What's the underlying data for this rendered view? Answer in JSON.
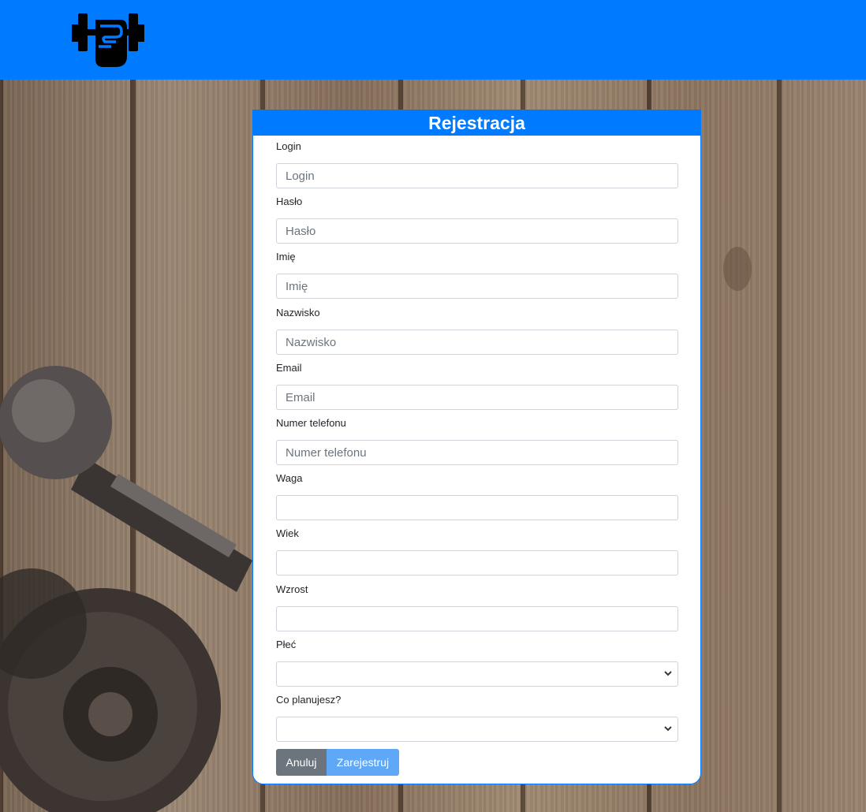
{
  "header": {
    "logo_icon": "dumbbell-fist-icon",
    "color": "#007bff"
  },
  "form": {
    "title": "Rejestracja",
    "fields": [
      {
        "label": "Login",
        "placeholder": "Login",
        "value": ""
      },
      {
        "label": "Hasło",
        "placeholder": "Hasło",
        "value": ""
      },
      {
        "label": "Imię",
        "placeholder": "Imię",
        "value": ""
      },
      {
        "label": "Nazwisko",
        "placeholder": "Nazwisko",
        "value": ""
      },
      {
        "label": "Email",
        "placeholder": "Email",
        "value": ""
      },
      {
        "label": "Numer telefonu",
        "placeholder": "Numer telefonu",
        "value": ""
      },
      {
        "label": "Waga",
        "placeholder": "",
        "value": ""
      },
      {
        "label": "Wiek",
        "placeholder": "",
        "value": ""
      },
      {
        "label": "Wzrost",
        "placeholder": "",
        "value": ""
      }
    ],
    "selects": [
      {
        "label": "Płeć",
        "selected": ""
      },
      {
        "label": "Co planujesz?",
        "selected": ""
      }
    ],
    "cancel_label": "Anuluj",
    "submit_label": "Zarejestruj"
  }
}
